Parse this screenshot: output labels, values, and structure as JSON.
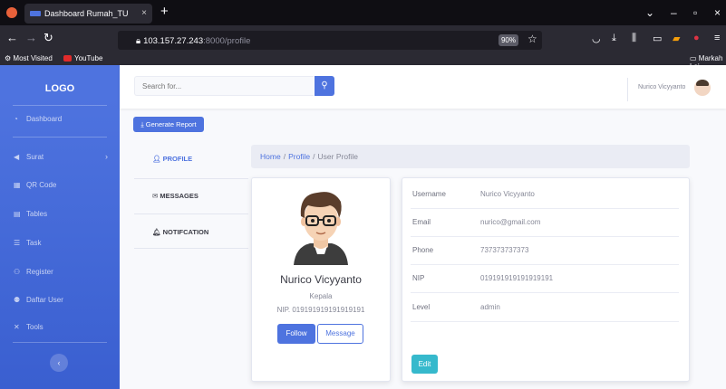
{
  "browser": {
    "tab_title": "Dashboard Rumah_TU",
    "tab_close": "×",
    "new_tab": "+",
    "url_host": "103.157.27.243",
    "url_path": ":8000/profile",
    "zoom": "90%",
    "bookmarks": [
      {
        "label": "Most Visited"
      },
      {
        "label": "YouTube"
      }
    ],
    "other_bookmarks": "Markah Lai"
  },
  "sidebar": {
    "logo": "LOGO",
    "items": [
      {
        "label": "Dashboard",
        "icon": "tachometer-icon"
      },
      {
        "label": "Surat",
        "icon": "paper-plane-icon",
        "expandable": true
      },
      {
        "label": "QR Code",
        "icon": "qrcode-icon"
      },
      {
        "label": "Tables",
        "icon": "table-icon"
      },
      {
        "label": "Task",
        "icon": "list-icon"
      },
      {
        "label": "Register",
        "icon": "user-plus-icon"
      },
      {
        "label": "Daftar User",
        "icon": "users-icon"
      },
      {
        "label": "Tools",
        "icon": "tools-icon"
      }
    ],
    "toggle_icon": "‹"
  },
  "topbar": {
    "search_placeholder": "Search for...",
    "user_name": "Nurico Vicyyanto"
  },
  "actions": {
    "generate_report": "Generate Report"
  },
  "profile_nav": [
    {
      "label": "PROFILE",
      "icon": "user-icon",
      "active": true
    },
    {
      "label": "MESSAGES",
      "icon": "envelope-icon",
      "active": false
    },
    {
      "label": "NOTIFCATION",
      "icon": "bell-icon",
      "active": false
    }
  ],
  "breadcrumb": {
    "home": "Home",
    "profile": "Profile",
    "current": "User Profile",
    "sep": "/"
  },
  "profile_card": {
    "name": "Nurico Vicyyanto",
    "role": "Kepala",
    "nip": "NIP. 019191919191919191",
    "follow": "Follow",
    "message": "Message"
  },
  "details": {
    "rows": [
      {
        "label": "Username",
        "value": "Nurico Vicyyanto"
      },
      {
        "label": "Email",
        "value": "nurico@gmail.com"
      },
      {
        "label": "Phone",
        "value": "737373737373"
      },
      {
        "label": "NIP",
        "value": "019191919191919191"
      },
      {
        "label": "Level",
        "value": "admin"
      }
    ],
    "edit": "Edit"
  },
  "colors": {
    "primary": "#4e73df",
    "info": "#36b9cc",
    "sidebar_bottom": "#3a5fd0",
    "browser_bg": "#1c1b22"
  }
}
